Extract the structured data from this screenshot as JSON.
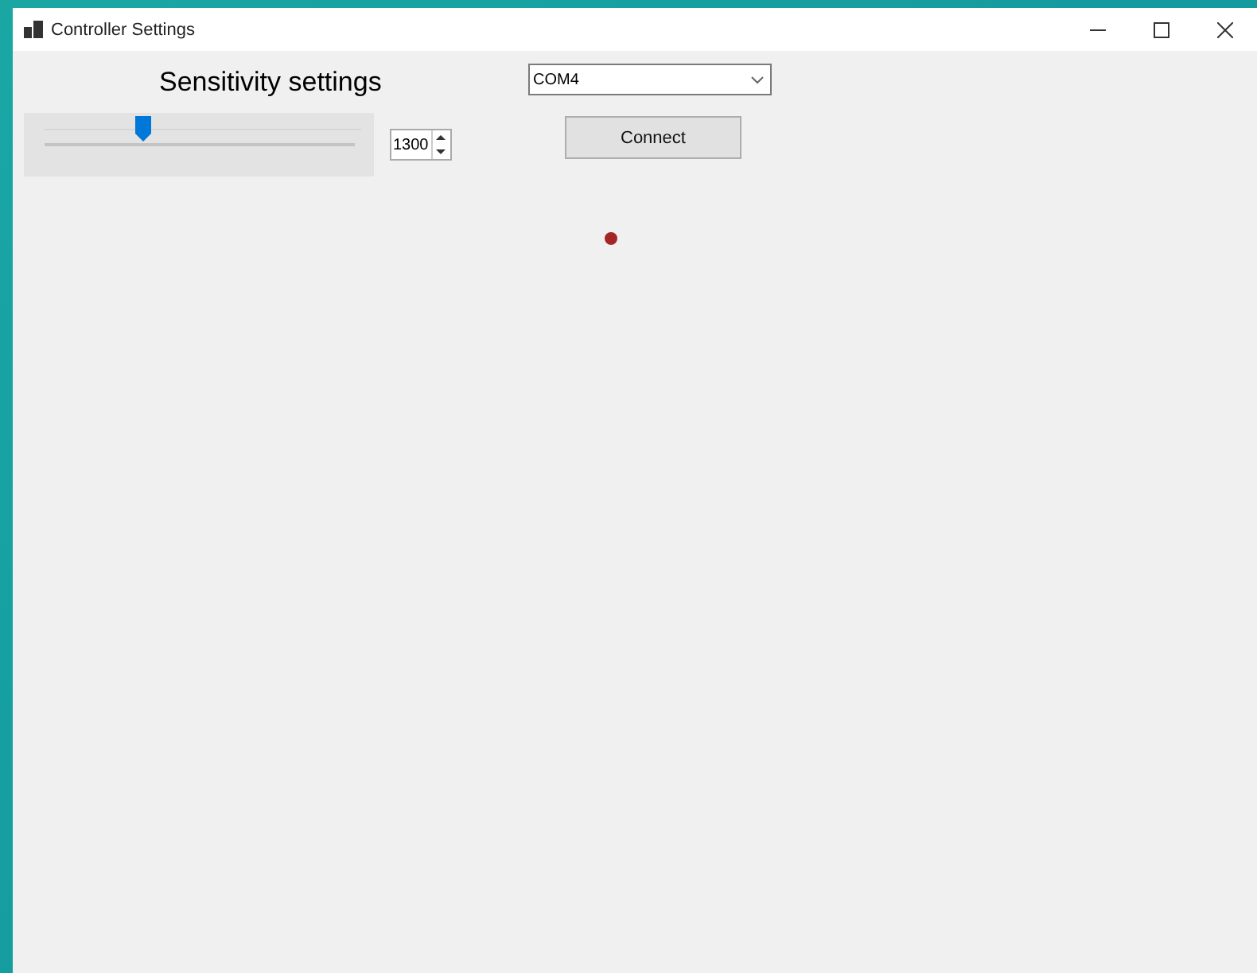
{
  "window": {
    "title": "Controller Settings"
  },
  "sensitivity": {
    "title": "Sensitivity settings",
    "slider": {
      "level": 0.32
    },
    "value": "1300"
  },
  "port": {
    "value": "COM4"
  },
  "connect_button": {
    "label": "Connect"
  },
  "status_dot": {
    "color": "#a52424"
  }
}
